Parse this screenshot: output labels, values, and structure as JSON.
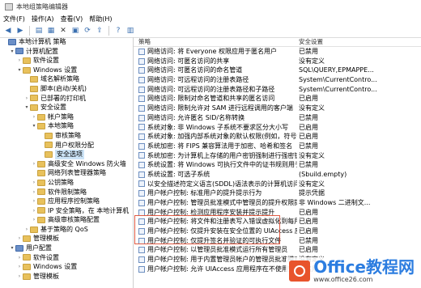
{
  "window": {
    "title": "本地组策略编辑器"
  },
  "menu": [
    "文件(F)",
    "操作(A)",
    "查看(V)",
    "帮助(H)"
  ],
  "toolbar": {
    "icons": [
      "back-icon",
      "forward-icon",
      "up-folder-icon",
      "show-hide-tree-icon",
      "delete-icon",
      "properties-icon",
      "refresh-icon",
      "export-icon",
      "help-icon",
      "show-pane-icon",
      "filter-icon"
    ]
  },
  "tree": [
    {
      "label": "本地计算机 策略",
      "level": 0,
      "arrow": "",
      "icon": "pc"
    },
    {
      "label": "计算机配置",
      "level": 1,
      "arrow": "▾",
      "icon": "pc"
    },
    {
      "label": "软件设置",
      "level": 2,
      "arrow": "›",
      "icon": "folder"
    },
    {
      "label": "Windows 设置",
      "level": 2,
      "arrow": "▾",
      "icon": "folder"
    },
    {
      "label": "域名解析策略",
      "level": 3,
      "arrow": "",
      "icon": "folder"
    },
    {
      "label": "脚本(启动/关机)",
      "level": 3,
      "arrow": "",
      "icon": "folder"
    },
    {
      "label": "已部署的打印机",
      "level": 3,
      "arrow": "›",
      "icon": "folder"
    },
    {
      "label": "安全设置",
      "level": 3,
      "arrow": "▾",
      "icon": "folder"
    },
    {
      "label": "帐户策略",
      "level": 4,
      "arrow": "›",
      "icon": "folder"
    },
    {
      "label": "本地策略",
      "level": 4,
      "arrow": "▾",
      "icon": "folder"
    },
    {
      "label": "审核策略",
      "level": 5,
      "arrow": "",
      "icon": "folder"
    },
    {
      "label": "用户权限分配",
      "level": 5,
      "arrow": "",
      "icon": "folder"
    },
    {
      "label": "安全选项",
      "level": 5,
      "arrow": "",
      "icon": "folder",
      "selected": true
    },
    {
      "label": "高级安全 Windows 防火墙",
      "level": 4,
      "arrow": "›",
      "icon": "folder"
    },
    {
      "label": "网络列表管理器策略",
      "level": 4,
      "arrow": "",
      "icon": "folder"
    },
    {
      "label": "公钥策略",
      "level": 4,
      "arrow": "›",
      "icon": "folder"
    },
    {
      "label": "软件限制策略",
      "level": 4,
      "arrow": "›",
      "icon": "folder"
    },
    {
      "label": "应用程序控制策略",
      "level": 4,
      "arrow": "›",
      "icon": "folder"
    },
    {
      "label": "IP 安全策略，在 本地计算机",
      "level": 4,
      "arrow": "›",
      "icon": "folder"
    },
    {
      "label": "高级审核策略配置",
      "level": 4,
      "arrow": "›",
      "icon": "folder"
    },
    {
      "label": "基于策略的 QoS",
      "level": 3,
      "arrow": "›",
      "icon": "folder"
    },
    {
      "label": "管理模板",
      "level": 2,
      "arrow": "›",
      "icon": "folder"
    },
    {
      "label": "用户配置",
      "level": 1,
      "arrow": "▾",
      "icon": "pc"
    },
    {
      "label": "软件设置",
      "level": 2,
      "arrow": "›",
      "icon": "folder"
    },
    {
      "label": "Windows 设置",
      "level": 2,
      "arrow": "›",
      "icon": "folder"
    },
    {
      "label": "管理模板",
      "level": 2,
      "arrow": "›",
      "icon": "folder"
    }
  ],
  "list": {
    "header_policy": "策略",
    "header_setting": "安全设置",
    "rows": [
      {
        "policy": "网络访问: 将 Everyone 权限应用于匿名用户",
        "setting": "已禁用"
      },
      {
        "policy": "网络访问: 可匿名访问的共享",
        "setting": "没有定义"
      },
      {
        "policy": "网络访问: 可匿名访问的命名管道",
        "setting": "SQL\\QUERY,EPMAPPE..."
      },
      {
        "policy": "网络访问: 可远程访问的注册表路径",
        "setting": "System\\CurrentContro..."
      },
      {
        "policy": "网络访问: 可远程访问的注册表路径和子路径",
        "setting": "System\\CurrentContro..."
      },
      {
        "policy": "网络访问: 限制对命名管道和共享的匿名访问",
        "setting": "已启用"
      },
      {
        "policy": "网络访问: 限制允许对 SAM 进行远程调用的客户端",
        "setting": "没有定义"
      },
      {
        "policy": "网络访问: 允许匿名 SID/名称转换",
        "setting": "已禁用"
      },
      {
        "policy": "系统对象: 非 Windows 子系统不要求区分大小写",
        "setting": "已启用"
      },
      {
        "policy": "系统对象: 加强内部系统对象的默认权限(例如，符号链接)",
        "setting": "已启用"
      },
      {
        "policy": "系统加密: 将 FIPS 兼容算法用于加密、哈希和签名",
        "setting": "已禁用"
      },
      {
        "policy": "系统加密: 为计算机上存储的用户密钥强制进行强密钥保护",
        "setting": "没有定义"
      },
      {
        "policy": "系统设置: 将 Windows 可执行文件中的证书规则用于软件...",
        "setting": "已禁用"
      },
      {
        "policy": "系统设置: 可选子系统",
        "setting": "(Sbuild.empty)"
      },
      {
        "policy": "以安全描述符定义语言(SDDL)语法表示的计算机访问限制",
        "setting": "没有定义"
      },
      {
        "policy": "用户帐户控制: 标准用户的提升提示行为",
        "setting": "提示凭据"
      },
      {
        "policy": "用户帐户控制: 管理员批准模式中管理员的提升权限提示的...",
        "setting": "非 Windows 二进制文..."
      },
      {
        "policy": "用户帐户控制: 检测应用程序安装并提示提升",
        "setting": "已启用"
      },
      {
        "policy": "用户帐户控制: 将文件和注册表写入错误虚拟化到每用户位置",
        "setting": "已启用"
      },
      {
        "policy": "用户帐户控制: 仅提升安装在安全位置的 UIAccess 应用程序",
        "setting": "已启用"
      },
      {
        "policy": "用户帐户控制: 仅提升签名并验证的可执行文件",
        "setting": "已禁用"
      },
      {
        "policy": "用户帐户控制: 以管理员批准模式运行所有管理员",
        "setting": "已启用"
      },
      {
        "policy": "用户帐户控制: 用于内置管理员帐户的管理员批准模式",
        "setting": "没有定义"
      },
      {
        "policy": "用户帐户控制: 允许 UIAccess 应用程序在不使用安全桌面...",
        "setting": "已禁用"
      }
    ]
  },
  "watermark": {
    "main": "Office教程网",
    "sub": "www.office26.com"
  }
}
